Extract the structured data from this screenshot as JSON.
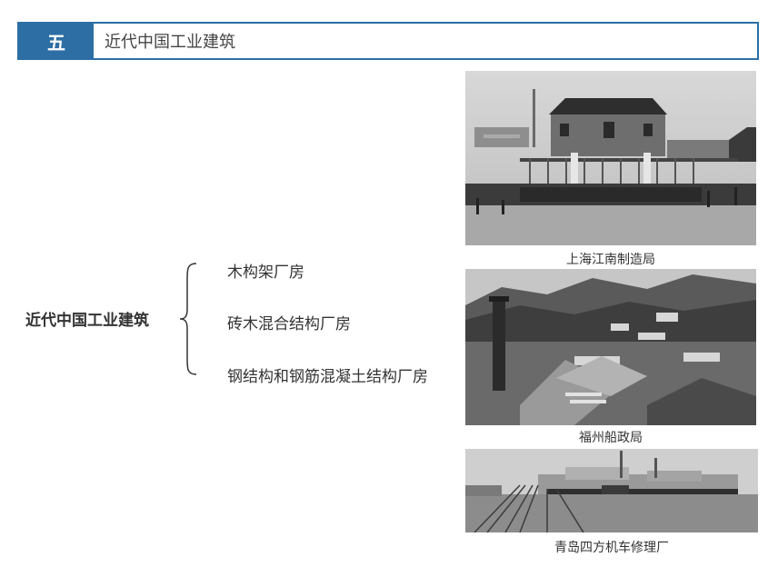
{
  "header": {
    "badge": "五",
    "title": "近代中国工业建筑"
  },
  "diagram": {
    "root": "近代中国工业建筑",
    "branches": [
      {
        "label": "木构架厂房"
      },
      {
        "label": "砖木混合结构厂房"
      },
      {
        "label": "钢结构和钢筋混凝土结构厂房"
      }
    ]
  },
  "photos": [
    {
      "caption": "上海江南制造局"
    },
    {
      "caption": "福州船政局"
    },
    {
      "caption": "青岛四方机车修理厂"
    }
  ]
}
